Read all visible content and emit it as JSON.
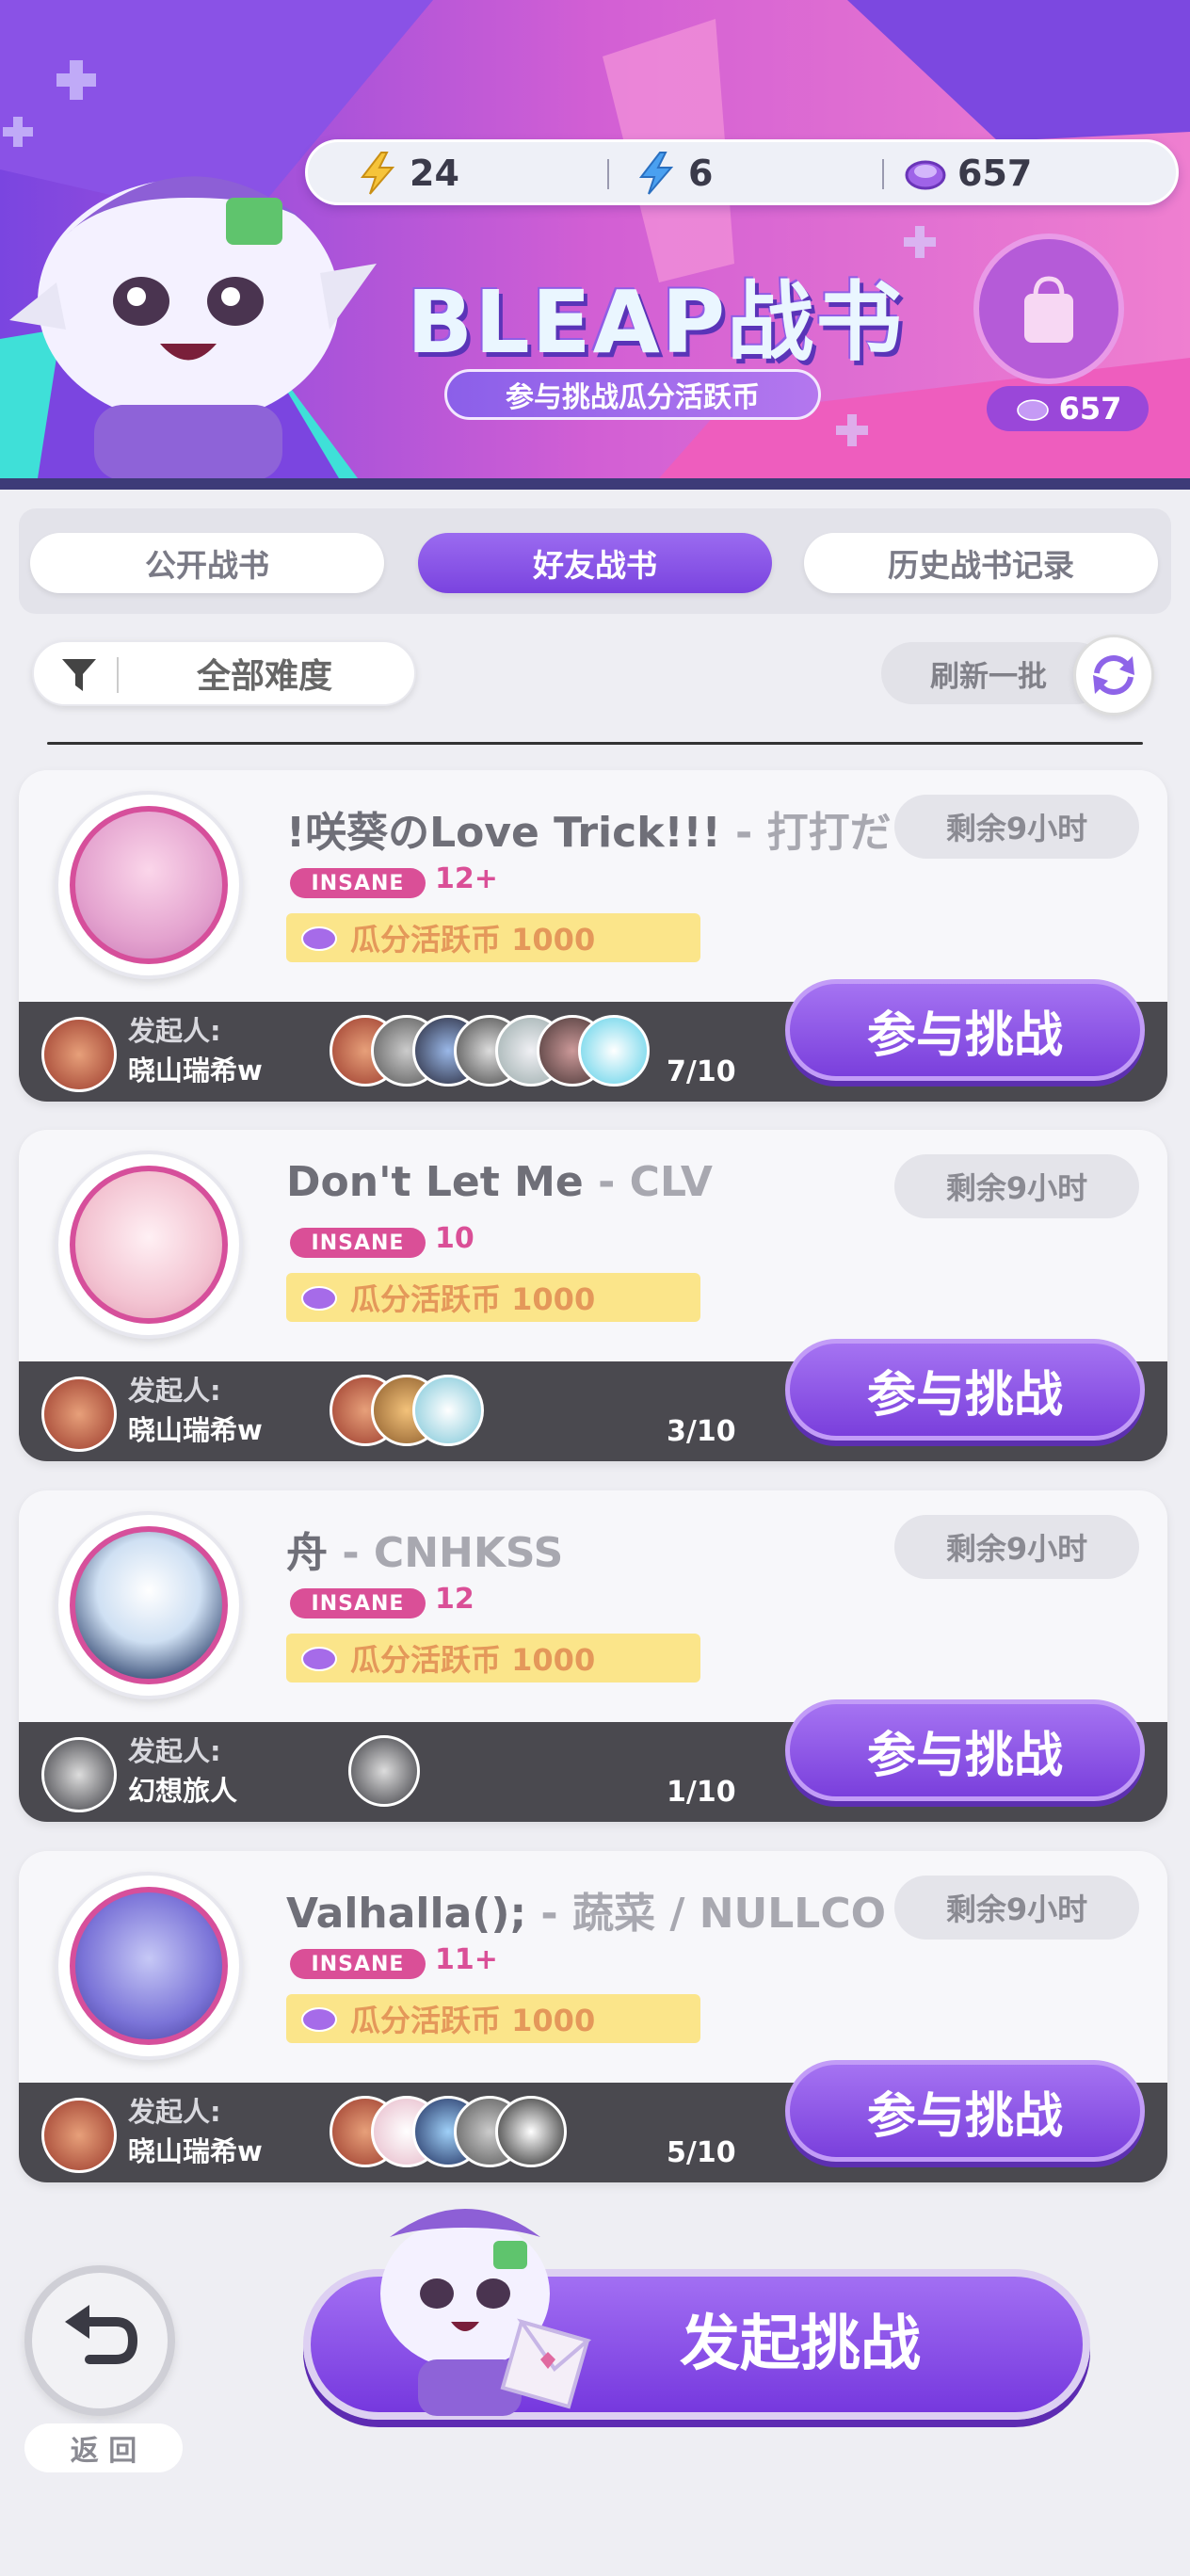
{
  "banner": {
    "title": "BLEAP战书",
    "subtitle": "参与挑战瓜分活跃币",
    "resources": [
      {
        "icon": "yellow-lightning-icon",
        "value": "24"
      },
      {
        "icon": "blue-lightning-icon",
        "value": "6"
      },
      {
        "icon": "purple-coin-icon",
        "value": "657"
      }
    ],
    "shop_coin_balance": "657"
  },
  "tabs": [
    {
      "label": "公开战书",
      "active": false
    },
    {
      "label": "好友战书",
      "active": true
    },
    {
      "label": "历史战书记录",
      "active": false
    }
  ],
  "filter": {
    "label": "全部难度"
  },
  "refresh": {
    "label": "刷新一批"
  },
  "challenges": [
    {
      "song": "!咲葵のLove Trick!!!",
      "artist": " - 打打だ",
      "time_left": "剩余9小时",
      "difficulty": "INSANE",
      "level": "12+",
      "reward": "瓜分活跃币 1000",
      "host_label": "发起人:",
      "host": "晓山瑞希w",
      "count": "7/10",
      "join_label": "参与挑战"
    },
    {
      "song": "Don't Let Me",
      "artist": " - CLV",
      "time_left": "剩余9小时",
      "difficulty": "INSANE",
      "level": "10",
      "reward": "瓜分活跃币 1000",
      "host_label": "发起人:",
      "host": "晓山瑞希w",
      "count": "3/10",
      "join_label": "参与挑战"
    },
    {
      "song": "舟",
      "artist": " - CNHKSS",
      "time_left": "剩余9小时",
      "difficulty": "INSANE",
      "level": "12",
      "reward": "瓜分活跃币 1000",
      "host_label": "发起人:",
      "host": "幻想旅人",
      "count": "1/10",
      "join_label": "参与挑战"
    },
    {
      "song": "Valhalla();",
      "artist": "  - 蔬菜 / NULLCO",
      "time_left": "剩余9小时",
      "difficulty": "INSANE",
      "level": "11+",
      "reward": "瓜分活跃币 1000",
      "host_label": "发起人:",
      "host": "晓山瑞希w",
      "count": "5/10",
      "join_label": "参与挑战"
    }
  ],
  "bottom": {
    "back_label": "返 回",
    "launch_label": "发起挑战"
  }
}
